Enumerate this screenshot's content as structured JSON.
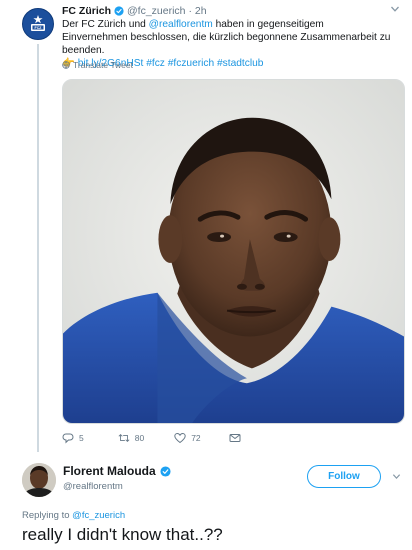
{
  "original_tweet": {
    "author_name": "FC Zürich",
    "handle": "@fc_zuerich",
    "separator": "·",
    "time": "2h",
    "text_before_mention": "Der FC Zürich und ",
    "mention": "@realflorentm",
    "text_after_mention": " haben in gegenseitigem Einvernehmen beschlossen, die kürzlich begonnene Zusammenarbeit zu beenden.",
    "link_emoji": "👉",
    "link": "bit.ly/2G6nHSt",
    "hashtags": "#fcz #fczuerich #stadtclub",
    "translate_label": "Translate Tweet",
    "replies": "5",
    "retweets": "80",
    "likes": "72"
  },
  "reply_tweet": {
    "author_name": "Florent Malouda",
    "handle": "@realflorentm",
    "follow_label": "Follow",
    "replying_prefix": "Replying to ",
    "replying_to": "@fc_zuerich",
    "text": "really I didn't know that..??"
  },
  "colors": {
    "link_blue": "#1b95e0",
    "follow_blue": "#1da1f2",
    "secondary_text": "#657786",
    "fcz_blue": "#1c4f9c"
  },
  "icons": [
    "fcz-crest-icon",
    "verified-badge-icon",
    "chevron-down-icon",
    "globe-icon",
    "reply-icon",
    "retweet-icon",
    "heart-icon",
    "message-icon"
  ]
}
